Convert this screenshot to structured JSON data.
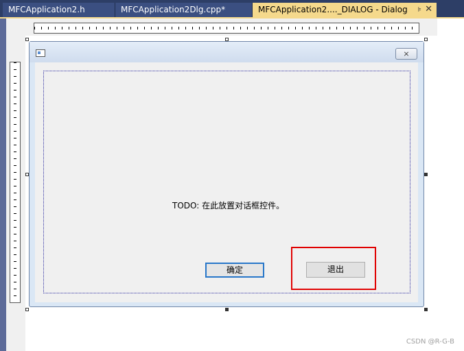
{
  "tabs": [
    {
      "label": "MFCApplication2.h"
    },
    {
      "label": "MFCApplication2Dlg.cpp*"
    },
    {
      "label": "MFCApplication2...._DIALOG - Dialog",
      "active": true
    }
  ],
  "tab_controls": {
    "pin_icon": "⊧",
    "close_icon": "✕"
  },
  "dialog": {
    "close_glyph": "⨯",
    "static_text": "TODO: 在此放置对话框控件。",
    "ok_label": "确定",
    "cancel_label": "退出"
  },
  "watermark": "CSDN @R-G-B",
  "colors": {
    "tab_bar": "#2d3e66",
    "active_tab": "#f5d98c",
    "highlight": "#e00000",
    "default_button_border": "#2676c9"
  }
}
